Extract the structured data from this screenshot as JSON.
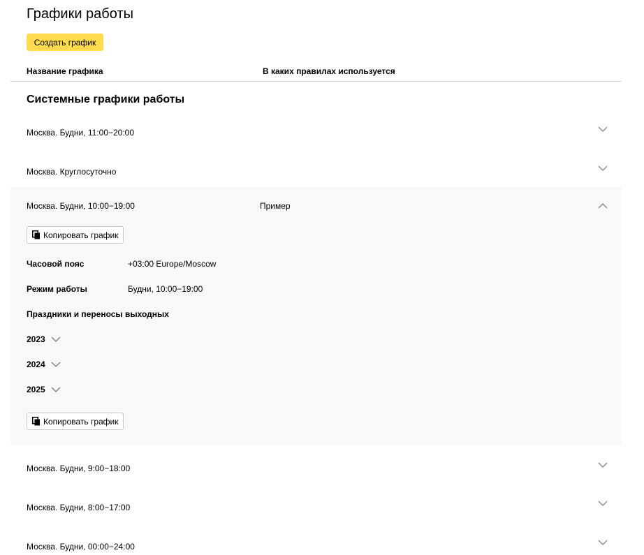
{
  "page": {
    "title": "Графики работы",
    "create_button": "Создать график"
  },
  "table": {
    "col_name": "Название графика",
    "col_rules": "В каких правилах используется"
  },
  "section": {
    "title": "Системные графики работы"
  },
  "rows": [
    {
      "label": "Москва. Будни, 11:00−20:00",
      "rule": ""
    },
    {
      "label": "Москва. Круглосуточно",
      "rule": ""
    },
    {
      "label": "Москва. Будни, 10:00−19:00",
      "rule": "Пример"
    },
    {
      "label": "Москва. Будни, 9:00−18:00",
      "rule": ""
    },
    {
      "label": "Москва. Будни, 8:00−17:00",
      "rule": ""
    },
    {
      "label": "Москва. Будни, 00:00−24:00",
      "rule": ""
    }
  ],
  "expanded": {
    "copy_button": "Копировать график",
    "timezone_label": "Часовой пояс",
    "timezone_value": "+03:00 Europe/Moscow",
    "mode_label": "Режим работы",
    "mode_value": "Будни, 10:00−19:00",
    "holidays_label": "Праздники и переносы выходных",
    "years": [
      "2023",
      "2024",
      "2025"
    ]
  },
  "icons": {
    "chevron_down": "chevron-down-icon",
    "chevron_up": "chevron-up-icon",
    "copy": "copy-icon"
  },
  "colors": {
    "accent": "#ffdb4d",
    "expanded_bg": "#f8f8f8"
  }
}
